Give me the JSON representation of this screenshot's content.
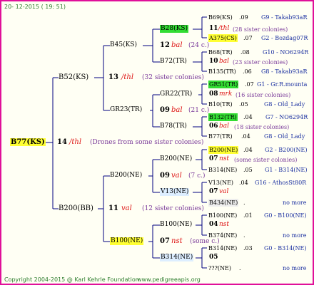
{
  "header": {
    "date": "20- 12-2015 ( 19: 51)"
  },
  "footer": {
    "copyright": "Copyright 2004-2015 @ Karl Kehrle Foundation.",
    "site": "www.pedigreeapis.org"
  },
  "root": {
    "name": "B77(KS)",
    "year": "14",
    "mating": "/thl",
    "note": "(Drones from some sister colonies)"
  },
  "gen1": [
    {
      "name": "B52(KS)",
      "year": "13",
      "mating": "/thl",
      "note": "(32 sister colonies)"
    },
    {
      "name": "B200(BB)",
      "year": "11",
      "mating": "val",
      "note": "(12 sister colonies)"
    }
  ],
  "gen2": [
    {
      "name": "B45(KS)",
      "year": "12",
      "mating": "bal",
      "note": "(24 c.)"
    },
    {
      "name": "GR23(TR)",
      "year": "09",
      "mating": "bal",
      "note": "(21 c.)"
    },
    {
      "name": "B200(NE)",
      "year": "09",
      "mating": "val",
      "note": "(7 c.)"
    },
    {
      "name": "B100(NE)",
      "year": "07",
      "mating": "nst",
      "note": "(some c.)"
    }
  ],
  "gen3": [
    {
      "name": "B28(KS)",
      "year": "11",
      "mating": "/thl",
      "note": "(28 sister colonies)"
    },
    {
      "name": "B72(TR)",
      "year": "10",
      "mating": "bal",
      "note": "(23 sister colonies)"
    },
    {
      "name": "GR22(TR)",
      "year": "08",
      "mating": "mrk",
      "note": "(16 sister colonies)"
    },
    {
      "name": "B78(TR)",
      "year": "06",
      "mating": "bal",
      "note": "(18 sister colonies)"
    },
    {
      "name": "B200(NE)",
      "year": "07",
      "mating": "nst",
      "note": "(some sister colonies)"
    },
    {
      "name": "V13(NE)",
      "year": "07",
      "mating": "val",
      "note": ""
    },
    {
      "name": "B100(NE)",
      "year": "04",
      "mating": "nst",
      "note": ""
    },
    {
      "name": "B314(NE)",
      "year": "05",
      "mating": "",
      "note": ""
    }
  ],
  "gen4": [
    {
      "name": "B69(KS)",
      "year": ".09",
      "ref": "G9 - Takab93aR"
    },
    {
      "name": "A375(CS)",
      "year": ".07",
      "ref": "G2 - Bozdag07R"
    },
    {
      "name": "B68(TR)",
      "year": ".08",
      "ref": "G10 - NO6294R"
    },
    {
      "name": "B135(TR)",
      "year": ".06",
      "ref": "G8 - Takab93aR"
    },
    {
      "name": "GR51(TR)",
      "year": ".07",
      "ref": "G1 - Gr.R.mounta"
    },
    {
      "name": "B10(TR)",
      "year": ".05",
      "ref": "G8 - Old_Lady"
    },
    {
      "name": "B132(TR)",
      "year": ".04",
      "ref": "G7 - NO6294R"
    },
    {
      "name": "B77(TR)",
      "year": ".04",
      "ref": "G8 - Old_Lady"
    },
    {
      "name": "B200(NE)",
      "year": ".04",
      "ref": "G2 - B200(NE)"
    },
    {
      "name": "B314(NE)",
      "year": ".05",
      "ref": "G1 - B314(NE)"
    },
    {
      "name": "V13(NE)",
      "year": ".04",
      "ref": "G16 - AthosSt80R"
    },
    {
      "name": "B434(NE)",
      "year": ".",
      "ref": "no more"
    },
    {
      "name": "B100(NE)",
      "year": ".01",
      "ref": "G0 - B100(NE)"
    },
    {
      "name": "B374(NE)",
      "year": ".",
      "ref": "no more"
    },
    {
      "name": "B314(NE)",
      "year": ".03",
      "ref": "G0 - B314(NE)"
    },
    {
      "name": "???(NE)",
      "year": ".",
      "ref": "no more"
    }
  ],
  "colors": {
    "border": "#e0109a",
    "background": "#fffff4",
    "line": "#000080",
    "mating": "#dd1111",
    "note": "#7a3a9a",
    "ref": "#1a2fa0",
    "footer": "#2e7d2e"
  }
}
